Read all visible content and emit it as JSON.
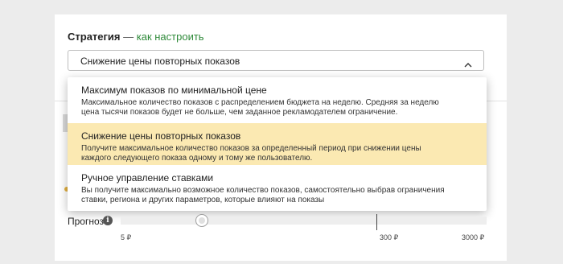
{
  "strategy": {
    "title": "Стратегия",
    "separator": " — ",
    "help_link": "как настроить",
    "selected_value": "Снижение цены повторных показов",
    "options": [
      {
        "title": "Максимум показов по минимальной цене",
        "desc_line1": "Максимальное количество показов с распределением бюджета на неделю. Средняя за неделю",
        "desc_line2": "цена тысячи показов будет не больше, чем заданное рекламодателем ограничение.",
        "selected": false
      },
      {
        "title": "Снижение цены повторных показов",
        "desc_line1": "Получите максимальное количество показов за определенный период при снижении цены",
        "desc_line2": "каждого следующего показа одному и тому же пользователю.",
        "selected": true
      },
      {
        "title": "Ручное управление ставками",
        "desc_line1": "Вы получите максимально возможное количество показов, самостоятельно выбрав ограничения",
        "desc_line2": "ставки, региона и других параметров, которые влияют на показы",
        "selected": false
      }
    ]
  },
  "forecast": {
    "label": "Прогноз",
    "info_glyph": "i",
    "scale_labels": [
      "5 ₽",
      "300 ₽",
      "3000 ₽"
    ]
  },
  "colors": {
    "link": "#2f8a3a",
    "selected_option_bg": "#fbe9b2"
  },
  "icons": {
    "select_chevron": "chevron-up-icon",
    "info": "info-icon"
  }
}
